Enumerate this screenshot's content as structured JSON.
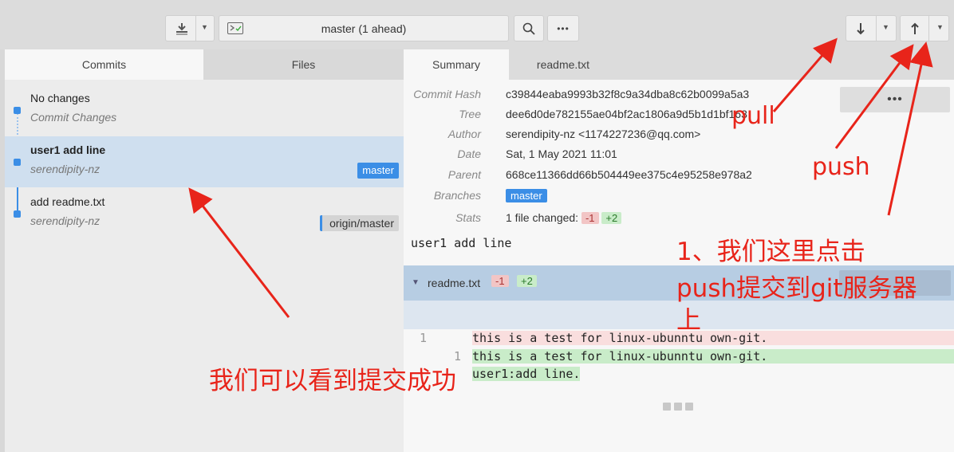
{
  "toolbar": {
    "branch_label": "master (1 ahead)",
    "more_label": "•••"
  },
  "left_tabs": [
    {
      "label": "Commits",
      "active": true
    },
    {
      "label": "Files",
      "active": false
    }
  ],
  "commits": [
    {
      "title": "No changes",
      "subtitle": "Commit Changes"
    },
    {
      "title": "user1 add line",
      "subtitle": "serendipity-nz",
      "badge": "master"
    },
    {
      "title": "add readme.txt",
      "subtitle": "serendipity-nz",
      "badge": "origin/master"
    }
  ],
  "right_tabs": [
    {
      "label": "Summary",
      "active": true
    },
    {
      "label": "readme.txt",
      "active": false
    }
  ],
  "details": {
    "hash_key": "Commit Hash",
    "hash": "c39844eaba9993b32f8c9a34dba8c62b0099a5a3",
    "tree_key": "Tree",
    "tree": "dee6d0de782155ae04bf2ac1806a9d5b1d1bf163",
    "author_key": "Author",
    "author": "serendipity-nz <1174227236@qq.com>",
    "date_key": "Date",
    "date": "Sat, 1 May 2021 11:01",
    "parent_key": "Parent",
    "parent": "668ce11366dd66b504449ee375c4e95258e978a2",
    "branches_key": "Branches",
    "branch": "master",
    "stats_key": "Stats",
    "stats_text": "1 file changed:",
    "stats_del": "-1",
    "stats_add": "+2",
    "more": "•••"
  },
  "commit_message": "user1 add line",
  "file": {
    "name": "readme.txt",
    "del": "-1",
    "add": "+2"
  },
  "diff": [
    {
      "old": "1",
      "new": "",
      "text": "this is a test for linux-ubunntu own-git.",
      "kind": "del"
    },
    {
      "old": "",
      "new": "1",
      "text": "this is a test for linux-ubunntu own-git.",
      "kind": "add"
    },
    {
      "old": "",
      "new": "",
      "text": "user1:add line.",
      "kind": "add"
    }
  ],
  "annotations": {
    "pull": "pull",
    "push": "push",
    "step1_line1": "1、我们这里点击",
    "step1_line2": "push提交到git服务器",
    "step1_line3": "上",
    "success": "我们可以看到提交成功"
  },
  "colors": {
    "accent": "#3b8ee6",
    "annotation": "#e8241a"
  }
}
